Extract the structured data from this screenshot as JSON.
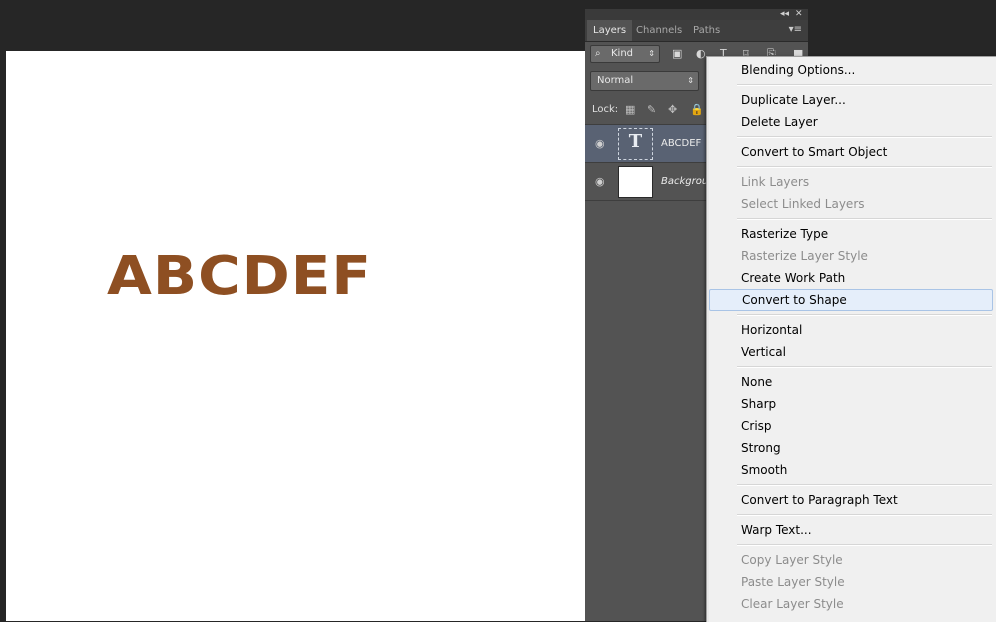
{
  "canvas": {
    "text": "ABCDEF",
    "text_color": "#8e4f22",
    "background": "#ffffff"
  },
  "panel": {
    "collapse_icon": "double-chevron-left-icon",
    "close_icon": "close-icon",
    "tabs": [
      {
        "label": "Layers",
        "active": true
      },
      {
        "label": "Channels",
        "active": false
      },
      {
        "label": "Paths",
        "active": false
      }
    ],
    "filter": {
      "label": "Kind"
    },
    "blend_mode": "Normal",
    "lock_label": "Lock:",
    "layers": [
      {
        "name": "ABCDEF",
        "type": "text",
        "visible": true,
        "selected": true
      },
      {
        "name": "Backgrou",
        "type": "background",
        "visible": true,
        "selected": false
      }
    ]
  },
  "context_menu": {
    "items": [
      {
        "label": "Blending Options...",
        "enabled": true
      },
      {
        "separator": true
      },
      {
        "label": "Duplicate Layer...",
        "enabled": true
      },
      {
        "label": "Delete Layer",
        "enabled": true
      },
      {
        "separator": true
      },
      {
        "label": "Convert to Smart Object",
        "enabled": true
      },
      {
        "separator": true
      },
      {
        "label": "Link Layers",
        "enabled": false
      },
      {
        "label": "Select Linked Layers",
        "enabled": false
      },
      {
        "separator": true
      },
      {
        "label": "Rasterize Type",
        "enabled": true
      },
      {
        "label": "Rasterize Layer Style",
        "enabled": false
      },
      {
        "label": "Create Work Path",
        "enabled": true
      },
      {
        "label": "Convert to Shape",
        "enabled": true,
        "hovered": true
      },
      {
        "separator": true
      },
      {
        "label": "Horizontal",
        "enabled": true
      },
      {
        "label": "Vertical",
        "enabled": true
      },
      {
        "separator": true
      },
      {
        "label": "None",
        "enabled": true
      },
      {
        "label": "Sharp",
        "enabled": true
      },
      {
        "label": "Crisp",
        "enabled": true
      },
      {
        "label": "Strong",
        "enabled": true
      },
      {
        "label": "Smooth",
        "enabled": true
      },
      {
        "separator": true
      },
      {
        "label": "Convert to Paragraph Text",
        "enabled": true
      },
      {
        "separator": true
      },
      {
        "label": "Warp Text...",
        "enabled": true
      },
      {
        "separator": true
      },
      {
        "label": "Copy Layer Style",
        "enabled": false
      },
      {
        "label": "Paste Layer Style",
        "enabled": false
      },
      {
        "label": "Clear Layer Style",
        "enabled": false
      }
    ]
  }
}
